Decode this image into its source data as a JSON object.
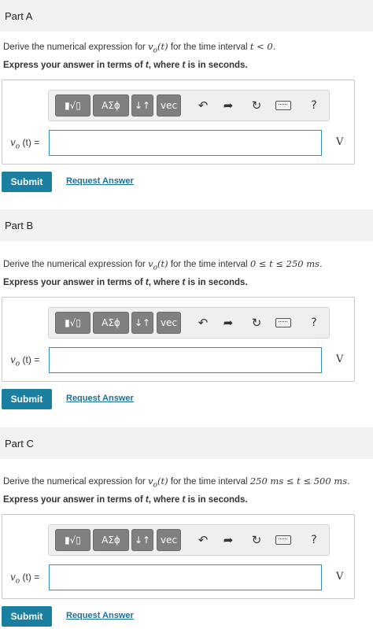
{
  "toolbar": {
    "template_label": "▮√▯",
    "greek_label": "AΣϕ",
    "arrows_label": "↓↑",
    "vec_label": "vec",
    "undo_glyph": "↶",
    "redo_glyph": "➦",
    "reset_glyph": "↻",
    "help_glyph": "?"
  },
  "parts": [
    {
      "title": "Part A",
      "prompt_before": "Derive the numerical expression for ",
      "func": "v",
      "func_sub": "o",
      "func_arg": "(t)",
      "prompt_middle": " for the time interval ",
      "interval": "t < 0.",
      "instruction_before": "Express your answer in terms of ",
      "instruction_var": "t",
      "instruction_after": ", where ",
      "instruction_var2": "t",
      "instruction_end": " is in seconds.",
      "eq_label": "(t) =",
      "input_value": "",
      "unit": "V",
      "submit": "Submit",
      "request": "Request Answer"
    },
    {
      "title": "Part B",
      "prompt_before": "Derive the numerical expression for ",
      "func": "v",
      "func_sub": "o",
      "func_arg": "(t)",
      "prompt_middle": " for the time interval ",
      "interval": "0 ≤ t ≤ 250 ms.",
      "instruction_before": "Express your answer in terms of ",
      "instruction_var": "t",
      "instruction_after": ", where ",
      "instruction_var2": "t",
      "instruction_end": " is in seconds.",
      "eq_label": "(t) =",
      "input_value": "",
      "unit": "V",
      "submit": "Submit",
      "request": "Request Answer"
    },
    {
      "title": "Part C",
      "prompt_before": "Derive the numerical expression for ",
      "func": "v",
      "func_sub": "o",
      "func_arg": "(t)",
      "prompt_middle": " for the time interval ",
      "interval": "250 ms ≤ t ≤ 500 ms.",
      "instruction_before": "Express your answer in terms of ",
      "instruction_var": "t",
      "instruction_after": ", where ",
      "instruction_var2": "t",
      "instruction_end": " is in seconds.",
      "eq_label": "(t) =",
      "input_value": "",
      "unit": "V",
      "submit": "Submit",
      "request": "Request Answer"
    }
  ]
}
